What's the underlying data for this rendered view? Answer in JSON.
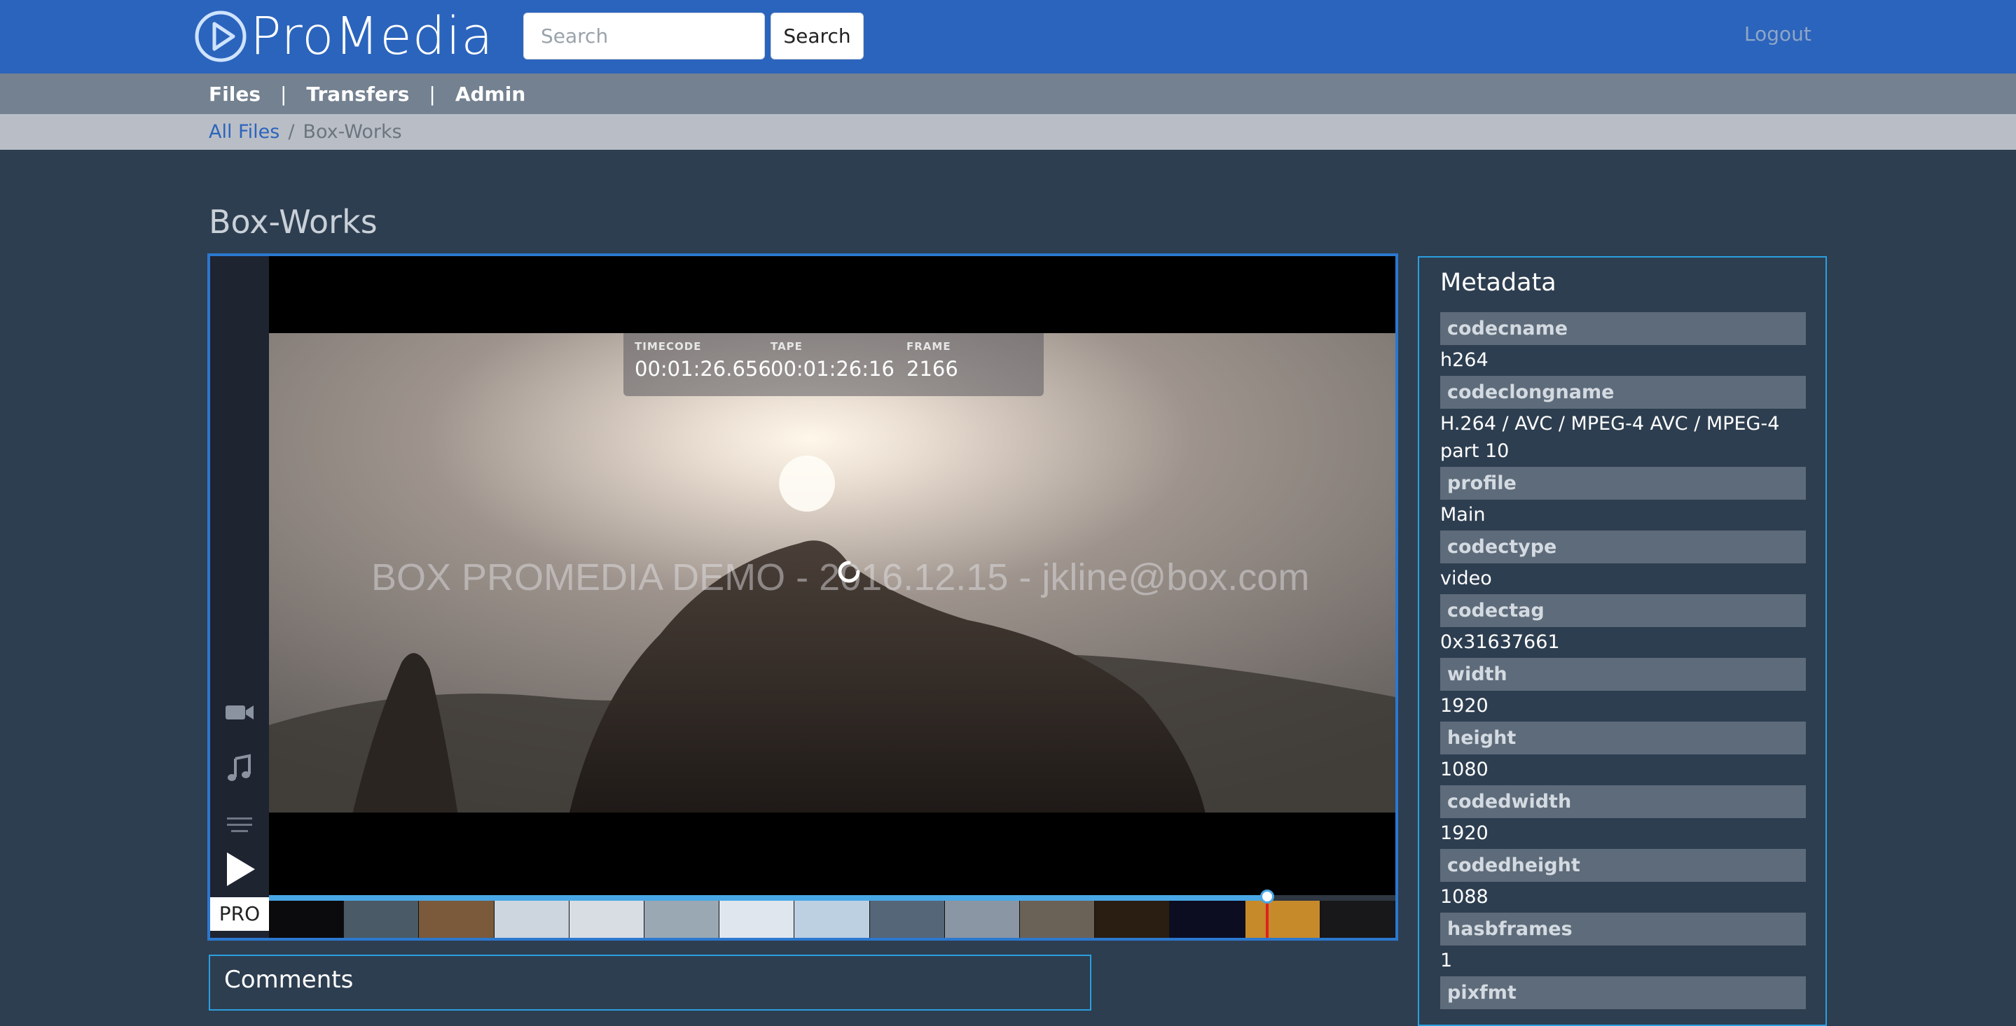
{
  "header": {
    "logo_text": "ProMedia",
    "search_placeholder": "Search",
    "search_button": "Search",
    "logout": "Logout"
  },
  "nav": {
    "items": [
      {
        "label": "Files"
      },
      {
        "label": "Transfers"
      },
      {
        "label": "Admin"
      }
    ],
    "separator": "|"
  },
  "breadcrumb": {
    "root": "All Files",
    "separator": "/",
    "current": "Box-Works"
  },
  "page": {
    "title": "Box-Works"
  },
  "player": {
    "overlay": {
      "timecode_label": "TIMECODE",
      "timecode_value": "00:01:26.656",
      "tape_label": "TAPE",
      "tape_value": "00:01:26:16",
      "frame_label": "FRAME",
      "frame_value": "2166"
    },
    "watermark": "BOX PROMEDIA DEMO - 2016.12.15 - jkline@box.com",
    "badge": "PRO",
    "progress": 0.885,
    "icons": {
      "video": "video-camera-icon",
      "audio": "music-note-icon",
      "captions": "text-lines-icon",
      "play": "play-icon"
    },
    "thumbnail_colors": [
      "#0b0b0d",
      "#4a5a66",
      "#7a5a3a",
      "#cdd5de",
      "#d8dde4",
      "#9aa8b4",
      "#dfe6ee",
      "#bcd0e2",
      "#556678",
      "#8a96a4",
      "#6b6257",
      "#2a1d12",
      "#0d0d22",
      "#c68a2a",
      "#18181a"
    ]
  },
  "comments": {
    "title": "Comments"
  },
  "metadata": {
    "title": "Metadata",
    "items": [
      {
        "key": "codecname",
        "value": "h264"
      },
      {
        "key": "codeclongname",
        "value": "H.264 / AVC / MPEG-4 AVC / MPEG-4 part 10"
      },
      {
        "key": "profile",
        "value": "Main"
      },
      {
        "key": "codectype",
        "value": "video"
      },
      {
        "key": "codectag",
        "value": "0x31637661"
      },
      {
        "key": "width",
        "value": "1920"
      },
      {
        "key": "height",
        "value": "1080"
      },
      {
        "key": "codedwidth",
        "value": "1920"
      },
      {
        "key": "codedheight",
        "value": "1088"
      },
      {
        "key": "hasbframes",
        "value": "1"
      },
      {
        "key": "pixfmt",
        "value": ""
      }
    ]
  },
  "colors": {
    "brand": "#2b64bd",
    "accent": "#2b9fe0",
    "background": "#2d3e50",
    "playhead": "#e02020"
  }
}
